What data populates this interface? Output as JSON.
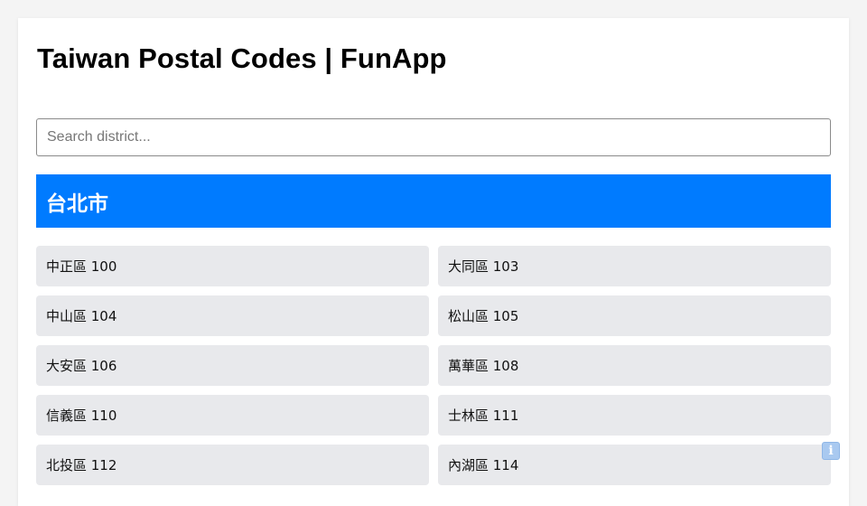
{
  "page": {
    "title": "Taiwan Postal Codes | FunApp"
  },
  "search": {
    "placeholder": "Search district...",
    "value": ""
  },
  "city": {
    "name": "台北市"
  },
  "districts": [
    {
      "label": "中正區 100"
    },
    {
      "label": "大同區 103"
    },
    {
      "label": "中山區 104"
    },
    {
      "label": "松山區 105"
    },
    {
      "label": "大安區 106"
    },
    {
      "label": "萬華區 108"
    },
    {
      "label": "信義區 110"
    },
    {
      "label": "士林區 111"
    },
    {
      "label": "北投區 112"
    },
    {
      "label": "內湖區 114"
    }
  ],
  "info": {
    "icon": "info-icon",
    "glyph": "i"
  },
  "colors": {
    "accent": "#007bff",
    "item_bg": "#e8e9ec",
    "page_bg": "#f4f4f4"
  }
}
